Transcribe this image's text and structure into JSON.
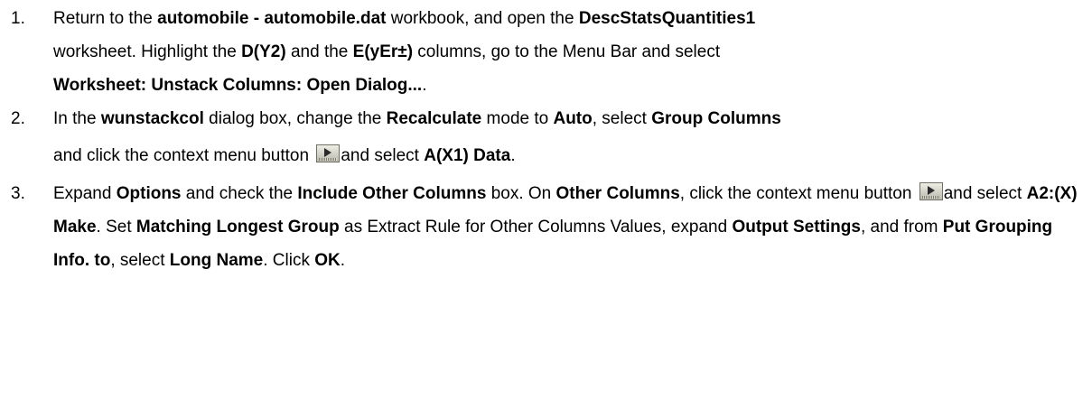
{
  "steps": [
    {
      "number": "1.",
      "t1": "Return to the ",
      "b1": "automobile - automobile.dat",
      "t2": " workbook, and open the ",
      "b2": "DescStatsQuantities1",
      "t3": " worksheet. Highlight the ",
      "b3": "D(Y2)",
      "t4": " and the ",
      "b4": "E(yEr±)",
      "t5": " columns, go to the Menu Bar and select ",
      "b5": "Worksheet: Unstack Columns: Open Dialog...",
      "t6": "."
    },
    {
      "number": "2.",
      "t1": "In the ",
      "b1": "wunstackcol",
      "t2": " dialog box, change the ",
      "b2": "Recalculate",
      "t3": " mode to ",
      "b3": "Auto",
      "t4": ", select ",
      "b4": "Group Columns",
      "t5": " and click the context menu button ",
      "t6": "and select ",
      "b5": "A(X1) Data",
      "t7": "."
    },
    {
      "number": "3.",
      "t1": "Expand ",
      "b1": "Options",
      "t2": " and check the ",
      "b2": "Include Other Columns",
      "t3": " box. On ",
      "b3": "Other Columns",
      "t4": ", click the context menu button ",
      "t5": "and select ",
      "b4": "A2:(X) Make",
      "t6": ". Set ",
      "b5": "Matching Longest Group",
      "t7": " as Extract Rule for Other Columns Values, expand ",
      "b6": "Output Settings",
      "t8": ", and from ",
      "b7": "Put Grouping Info. to",
      "t9": ", select ",
      "b8": "Long Name",
      "t10": ". Click ",
      "b9": "OK",
      "t11": "."
    }
  ],
  "icons": {
    "context_menu_button": "context-menu-button-icon"
  }
}
